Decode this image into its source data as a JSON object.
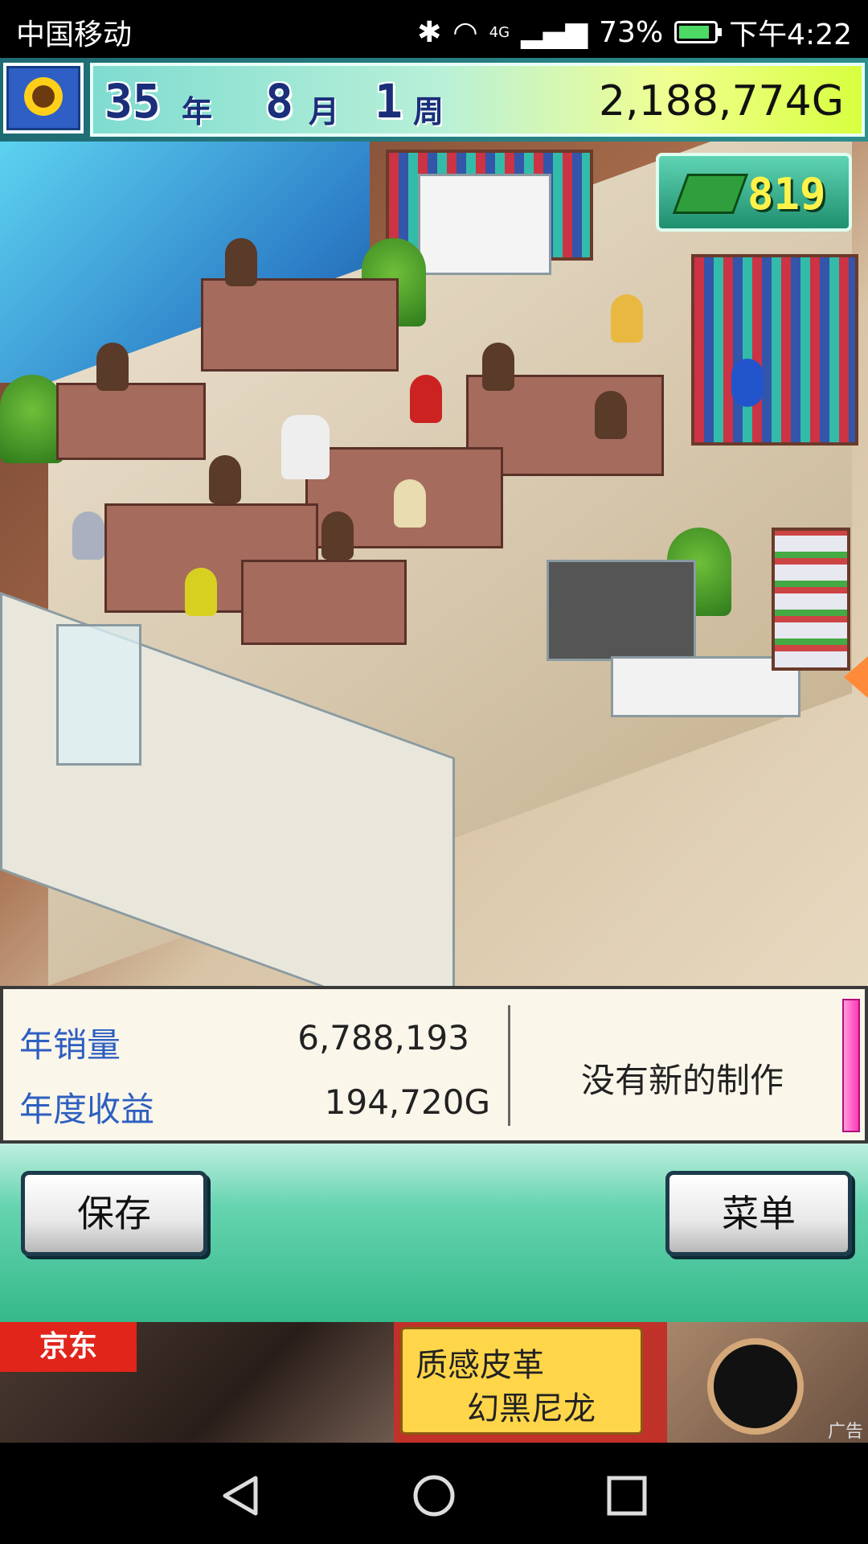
{
  "status_bar": {
    "carrier": "中国移动",
    "network": "4G",
    "battery": "73%",
    "time": "下午4:22"
  },
  "top_bar": {
    "year_num": "35",
    "year_unit": "年",
    "month_num": "8",
    "month_unit": "月",
    "week_num": "1",
    "week_unit": "周",
    "money": "2,188,774G"
  },
  "scene": {
    "ticket_count": "819"
  },
  "stats": {
    "annual_sales_label": "年销量",
    "annual_sales_value": "6,788,193",
    "annual_profit_label": "年度收益",
    "annual_profit_value": "194,720G",
    "production_status": "没有新的制作"
  },
  "buttons": {
    "save": "保存",
    "menu": "菜单"
  },
  "ad": {
    "brand": "京东",
    "line1": "质感皮革",
    "line2": "幻黑尼龙",
    "tag": "广告"
  },
  "colors": {
    "accent_teal": "#35b98a",
    "label_blue": "#2d5fc0",
    "money_bg_end": "#d8ff40"
  }
}
